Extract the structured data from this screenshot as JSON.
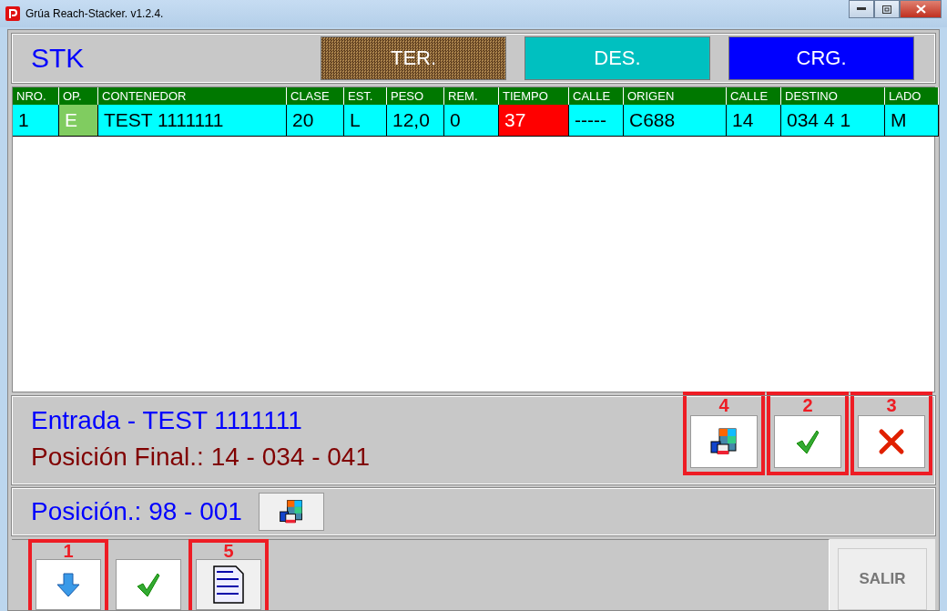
{
  "window": {
    "title": "Grúa Reach-Stacker. v1.2.4."
  },
  "header": {
    "label": "STK",
    "modes": [
      {
        "label": "TER.",
        "color": "#b08850",
        "disabled": true
      },
      {
        "label": "DES.",
        "color": "#00c0c0",
        "disabled": false
      },
      {
        "label": "CRG.",
        "color": "#0000ff",
        "disabled": false
      }
    ]
  },
  "table": {
    "columns": [
      "NRO.",
      "OP.",
      "CONTENEDOR",
      "CLASE",
      "EST.",
      "PESO",
      "REM.",
      "TIEMPO",
      "CALLE",
      "ORIGEN",
      "CALLE",
      "DESTINO",
      "LADO"
    ],
    "rows": [
      {
        "cells": [
          {
            "text": "1",
            "color": "#00ffff"
          },
          {
            "text": "E",
            "color": "#80cc60"
          },
          {
            "text": "TEST 1111111",
            "color": "#00ffff"
          },
          {
            "text": "20",
            "color": "#00ffff"
          },
          {
            "text": "L",
            "color": "#00ffff"
          },
          {
            "text": "12,0",
            "color": "#00ffff"
          },
          {
            "text": "0",
            "color": "#00ffff"
          },
          {
            "text": "37",
            "color": "#ff0000"
          },
          {
            "text": "-----",
            "color": "#00ffff"
          },
          {
            "text": "C688",
            "color": "#00ffff"
          },
          {
            "text": "14",
            "color": "#00ffff"
          },
          {
            "text": "034 4 1",
            "color": "#00ffff"
          },
          {
            "text": "M",
            "color": "#00ffff"
          }
        ]
      }
    ]
  },
  "info": {
    "line_1": "Entrada - TEST 1111111",
    "line_2": "Posición Final.: 14 - 034 - 041",
    "buttons": [
      {
        "kind": "blocks",
        "callout": "4"
      },
      {
        "kind": "check",
        "callout": "2"
      },
      {
        "kind": "cross",
        "callout": "3"
      }
    ]
  },
  "position": {
    "text": "Posición.: 98 - 001",
    "button": {
      "kind": "blocks"
    }
  },
  "toolbar": {
    "buttons": [
      {
        "kind": "down",
        "callout": "1"
      },
      {
        "kind": "check"
      },
      {
        "kind": "binary",
        "callout": "5"
      }
    ],
    "exit": "SALIR"
  }
}
